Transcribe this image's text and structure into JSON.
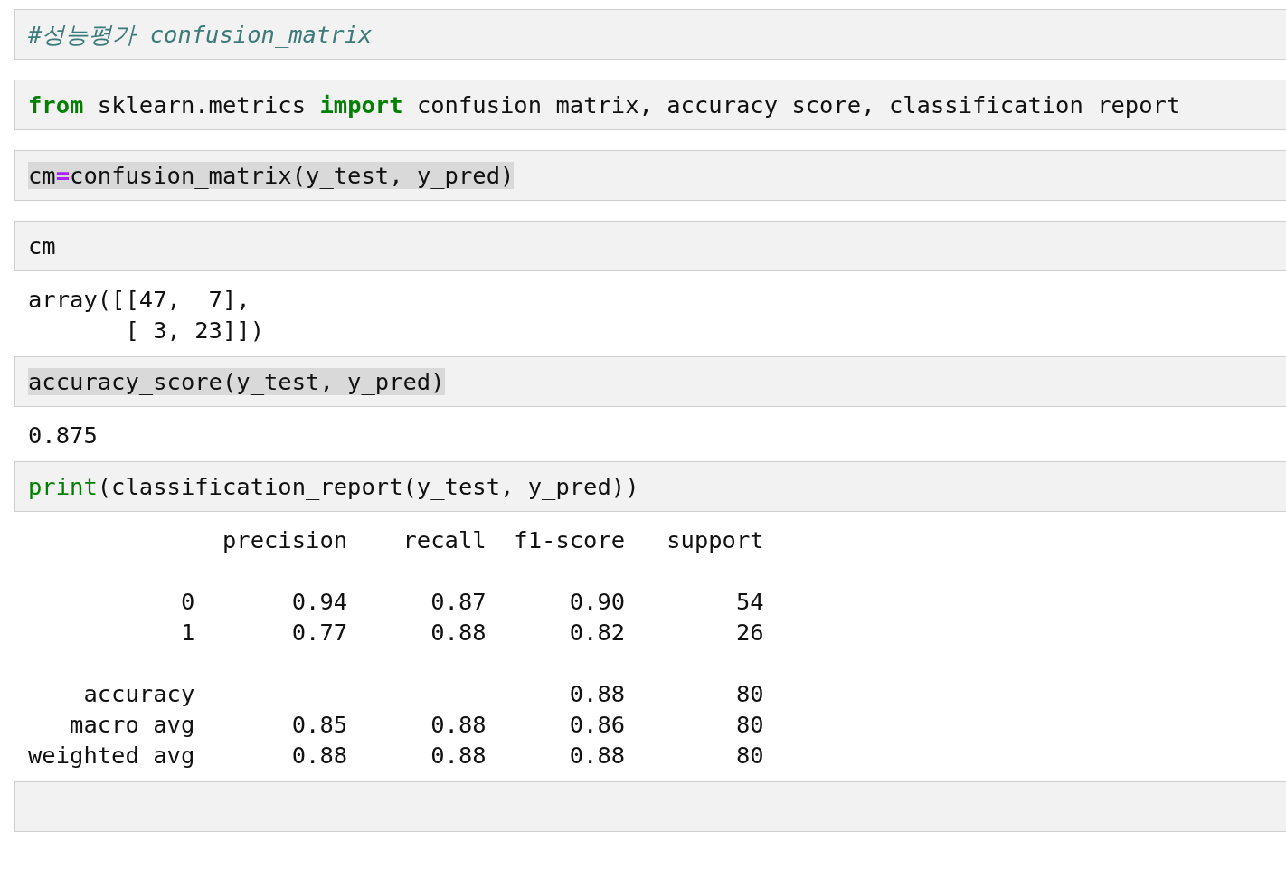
{
  "cells": [
    {
      "kind": "code",
      "tokens": [
        {
          "kind": "comment",
          "text": "#성능평가 confusion_matrix"
        }
      ]
    },
    {
      "kind": "code",
      "tokens": [
        {
          "kind": "keyword",
          "text": "from"
        },
        {
          "kind": "plain",
          "text": " sklearn.metrics "
        },
        {
          "kind": "keyword",
          "text": "import"
        },
        {
          "kind": "plain",
          "text": " confusion_matrix, accuracy_score, classification_report"
        }
      ]
    },
    {
      "kind": "code",
      "highlighted": true,
      "tokens": [
        {
          "kind": "plain",
          "text": "cm"
        },
        {
          "kind": "operator",
          "text": "="
        },
        {
          "kind": "plain",
          "text": "confusion_matrix(y_test, y_pred)"
        }
      ]
    },
    {
      "kind": "code",
      "tokens": [
        {
          "kind": "plain",
          "text": "cm"
        }
      ]
    },
    {
      "kind": "output",
      "text": "array([[47,  7],\n       [ 3, 23]])"
    },
    {
      "kind": "code",
      "highlighted": true,
      "tokens": [
        {
          "kind": "plain",
          "text": "accuracy_score(y_test, y_pred)"
        }
      ]
    },
    {
      "kind": "output",
      "text": "0.875"
    },
    {
      "kind": "code",
      "tokens": [
        {
          "kind": "builtin",
          "text": "print"
        },
        {
          "kind": "plain",
          "text": "(classification_report(y_test, y_pred))"
        }
      ]
    },
    {
      "kind": "output",
      "text": "              precision    recall  f1-score   support\n\n           0       0.94      0.87      0.90        54\n           1       0.77      0.88      0.82        26\n\n    accuracy                           0.88        80\n   macro avg       0.85      0.88      0.86        80\nweighted avg       0.88      0.88      0.88        80\n"
    },
    {
      "kind": "code"
    }
  ]
}
